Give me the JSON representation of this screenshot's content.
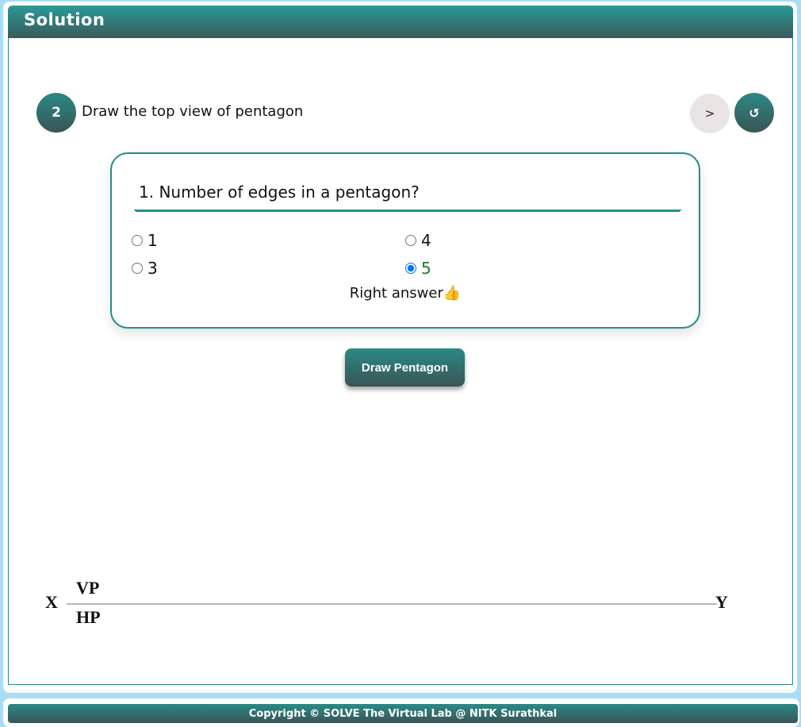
{
  "panel": {
    "title": "Solution"
  },
  "step": {
    "number": "2",
    "instruction": "Draw the top view of pentagon",
    "next_label": ">",
    "reset_label": "↺"
  },
  "quiz": {
    "question": "1. Number of edges in a pentagon?",
    "options": [
      {
        "label": "1",
        "selected": false
      },
      {
        "label": "4",
        "selected": false
      },
      {
        "label": "3",
        "selected": false
      },
      {
        "label": "5",
        "selected": true
      }
    ],
    "feedback": "Right answer👍",
    "correct_color": "#1f7a1f"
  },
  "action": {
    "draw_label": "Draw Pentagon"
  },
  "reference_line": {
    "x_label": "X",
    "y_label": "Y",
    "vp_label": "VP",
    "hp_label": "HP"
  },
  "footer": {
    "copyright": "Copyright © SOLVE The Virtual Lab @ NITK Surathkal"
  },
  "colors": {
    "accent": "#2a8a86",
    "page_background": "#a9dcf5"
  }
}
